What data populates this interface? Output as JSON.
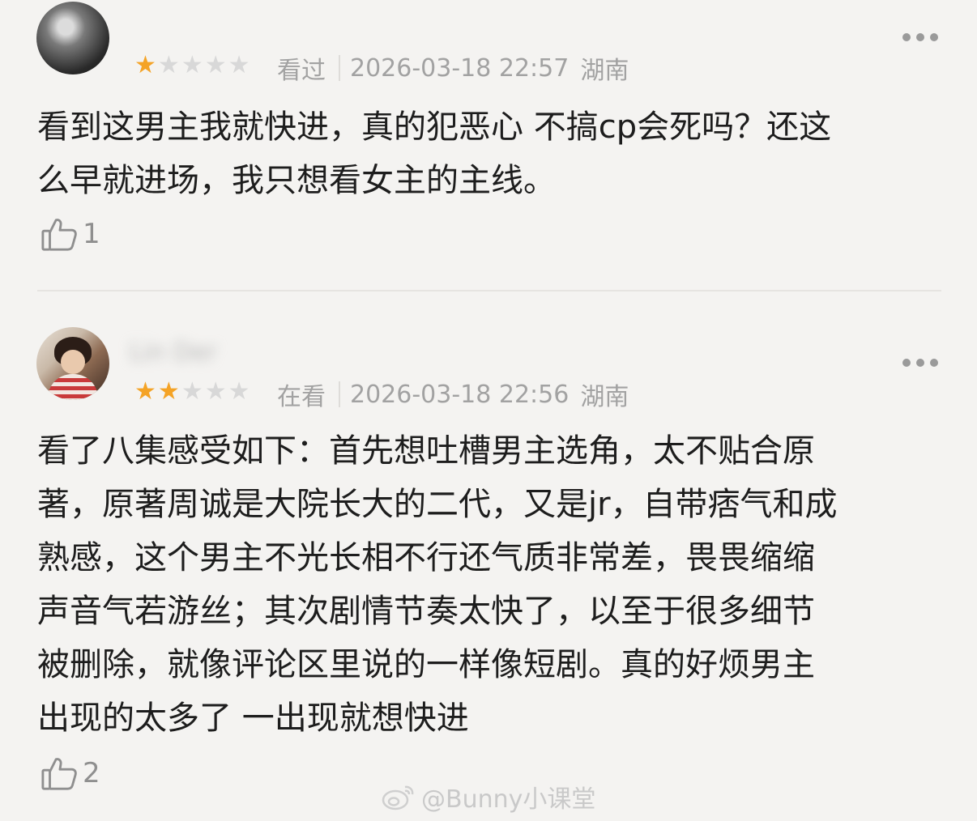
{
  "reviews": [
    {
      "username": "",
      "rating": 1,
      "max_rating": 5,
      "status": "看过",
      "timestamp": "2026-03-18 22:57",
      "location": "湖南",
      "content": "看到这男主我就快进，真的犯恶心 不搞cp会死吗？还这\n么早就进场，我只想看女主的主线。",
      "likes": "1"
    },
    {
      "username": "Lin Der",
      "rating": 2,
      "max_rating": 5,
      "status": "在看",
      "timestamp": "2026-03-18 22:56",
      "location": "湖南",
      "content": "看了八集感受如下：首先想吐槽男主选角，太不贴合原\n著，原著周诚是大院长大的二代，又是jr，自带痞气和成\n熟感，这个男主不光长相不行还气质非常差，畏畏缩缩\n声音气若游丝；其次剧情节奏太快了，以至于很多细节\n被删除，就像评论区里说的一样像短剧。真的好烦男主\n出现的太多了 一出现就想快进",
      "likes": "2"
    }
  ],
  "watermark": "@Bunny小课堂",
  "colors": {
    "background": "#f4f3f1",
    "star_on": "#f4a326",
    "star_off": "#d8d8d8",
    "meta_text": "#a2a2a2"
  },
  "icons": [
    "more-icon",
    "thumbs-up-icon",
    "star-icon",
    "weibo-logo-icon"
  ]
}
